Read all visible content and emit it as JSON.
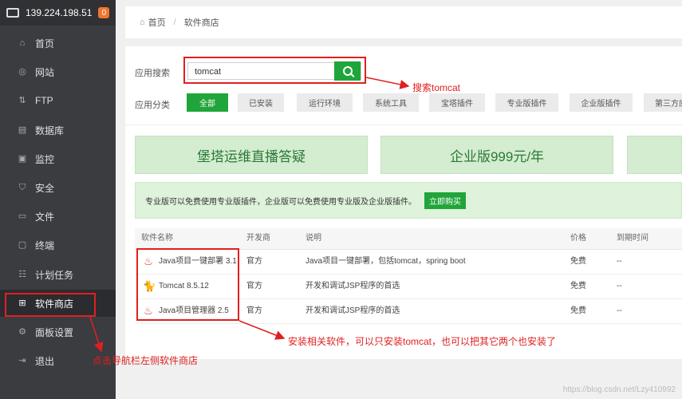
{
  "sidebar": {
    "server_ip": "139.224.198.51",
    "badge": "0",
    "items": [
      {
        "label": "首页",
        "icon": "home-icon"
      },
      {
        "label": "网站",
        "icon": "globe-icon"
      },
      {
        "label": "FTP",
        "icon": "ftp-icon"
      },
      {
        "label": "数据库",
        "icon": "database-icon"
      },
      {
        "label": "监控",
        "icon": "monitor-icon"
      },
      {
        "label": "安全",
        "icon": "shield-icon"
      },
      {
        "label": "文件",
        "icon": "folder-icon"
      },
      {
        "label": "终端",
        "icon": "terminal-icon"
      },
      {
        "label": "计划任务",
        "icon": "task-icon"
      },
      {
        "label": "软件商店",
        "icon": "grid-icon"
      },
      {
        "label": "面板设置",
        "icon": "gear-icon"
      },
      {
        "label": "退出",
        "icon": "logout-icon"
      }
    ]
  },
  "breadcrumb": {
    "home": "首页",
    "separator": "/",
    "current": "软件商店"
  },
  "search": {
    "label": "应用搜索",
    "value": "tomcat"
  },
  "categories": {
    "label": "应用分类",
    "items": [
      "全部",
      "已安装",
      "运行环境",
      "系统工具",
      "宝塔插件",
      "专业版插件",
      "企业版插件",
      "第三方应"
    ]
  },
  "banners": [
    "堡塔运维直播答疑",
    "企业版999元/年"
  ],
  "notice": {
    "text": "专业版可以免费使用专业版插件，企业版可以免费使用专业版及企业版插件。",
    "button": "立即购买"
  },
  "table": {
    "headers": [
      "软件名称",
      "开发商",
      "说明",
      "价格",
      "到期时间"
    ],
    "rows": [
      {
        "name": "Java项目一键部署 3.1",
        "dev": "官方",
        "desc": "Java项目一键部署，包括tomcat，spring boot",
        "price": "免费",
        "expire": "--"
      },
      {
        "name": "Tomcat 8.5.12",
        "dev": "官方",
        "desc": "开发和调试JSP程序的首选",
        "price": "免费",
        "expire": "--"
      },
      {
        "name": "Java项目管理器 2.5",
        "dev": "官方",
        "desc": "开发和调试JSP程序的首选",
        "price": "免费",
        "expire": "--"
      }
    ]
  },
  "annotations": {
    "search": "搜索tomcat",
    "install": "安装相关软件，可以只安装tomcat，也可以把其它两个也安装了",
    "nav": "点击导航栏左侧软件商店"
  },
  "watermark": "https://blog.csdn.net/Lzy410992",
  "colors": {
    "accent": "#20a53a",
    "sidebar": "#3a3c40",
    "annotation": "#e02020"
  }
}
